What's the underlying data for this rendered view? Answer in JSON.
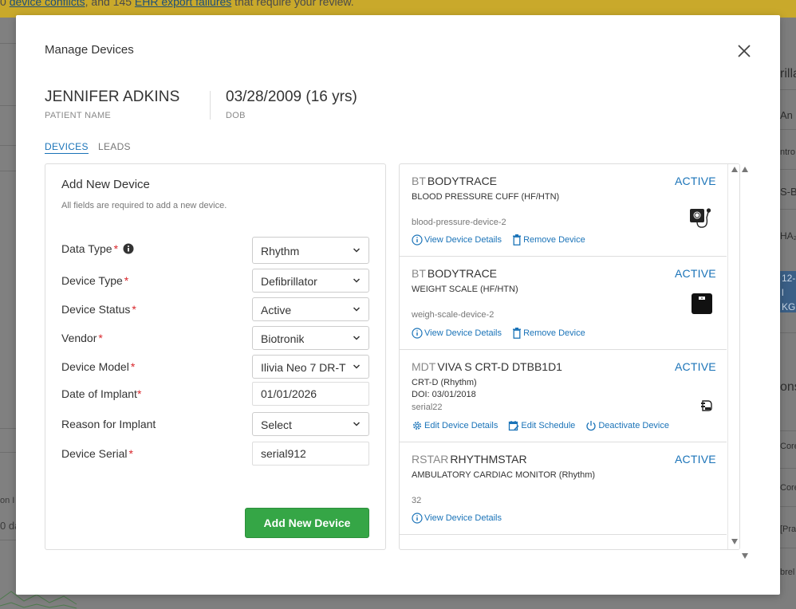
{
  "background": {
    "banner_pre": "0 ",
    "banner_link1": "device conflicts",
    "banner_mid": ", and 145 ",
    "banner_link2": "EHR export failures",
    "banner_post": " that require your review.",
    "right_fragments": [
      "rilla",
      "An",
      "ntro",
      "S-B",
      "HA₂",
      "12-l",
      "KG",
      "ons",
      "Core",
      "Core",
      "[Pra",
      "brel"
    ],
    "left_fragments": [
      "on I",
      "0 da"
    ]
  },
  "modal": {
    "title": "Manage Devices",
    "patient": {
      "name": "JENNIFER ADKINS",
      "name_label": "PATIENT NAME",
      "dob": "03/28/2009 (16 yrs)",
      "dob_label": "DOB"
    },
    "tabs": [
      {
        "label": "DEVICES",
        "active": true
      },
      {
        "label": "LEADS",
        "active": false
      }
    ],
    "add_form": {
      "title": "Add New Device",
      "subtitle": "All fields are required to add a new device.",
      "fields": [
        {
          "label": "Data Type",
          "value": "Rhythm",
          "type": "select"
        },
        {
          "label": "Device Type",
          "value": "Defibrillator",
          "type": "select"
        },
        {
          "label": "Device Status",
          "value": "Active",
          "type": "select"
        },
        {
          "label": "Vendor",
          "value": "Biotronik",
          "type": "select"
        },
        {
          "label": "Device Model",
          "value": "Ilivia Neo 7 DR-T",
          "type": "select"
        },
        {
          "label": "Date of Implant",
          "value": "01/01/2026",
          "type": "input"
        },
        {
          "label": "Reason for Implant",
          "value": "Select",
          "type": "select"
        },
        {
          "label": "Device Serial",
          "value": "serial912",
          "type": "input"
        }
      ],
      "required_mark": "*",
      "submit_label": "Add New Device"
    },
    "devices": [
      {
        "vendor": "BT",
        "name": "BODYTRACE",
        "status": "ACTIVE",
        "type": "BLOOD PRESSURE CUFF (HF/HTN)",
        "serial": "blood-pressure-device-2",
        "icon": "blood-pressure-cuff-icon",
        "actions": [
          "View Device Details",
          "Remove Device"
        ]
      },
      {
        "vendor": "BT",
        "name": "BODYTRACE",
        "status": "ACTIVE",
        "type": "WEIGHT SCALE (HF/HTN)",
        "serial": "weigh-scale-device-2",
        "icon": "weight-scale-icon",
        "actions": [
          "View Device Details",
          "Remove Device"
        ]
      },
      {
        "vendor": "MDT",
        "name": "VIVA S CRT-D DTBB1D1",
        "status": "ACTIVE",
        "type": "CRT-D (Rhythm)",
        "doi": "DOI: 03/01/2018",
        "serial": "serial22",
        "icon": "implant-device-icon",
        "actions": [
          "Edit Device Details",
          "Edit Schedule",
          "Deactivate Device"
        ]
      },
      {
        "vendor": "RSTAR",
        "name": "RHYTHMSTAR",
        "status": "ACTIVE",
        "type": "AMBULATORY CARDIAC MONITOR (Rhythm)",
        "serial": "32",
        "actions": [
          "View Device Details"
        ]
      }
    ]
  }
}
